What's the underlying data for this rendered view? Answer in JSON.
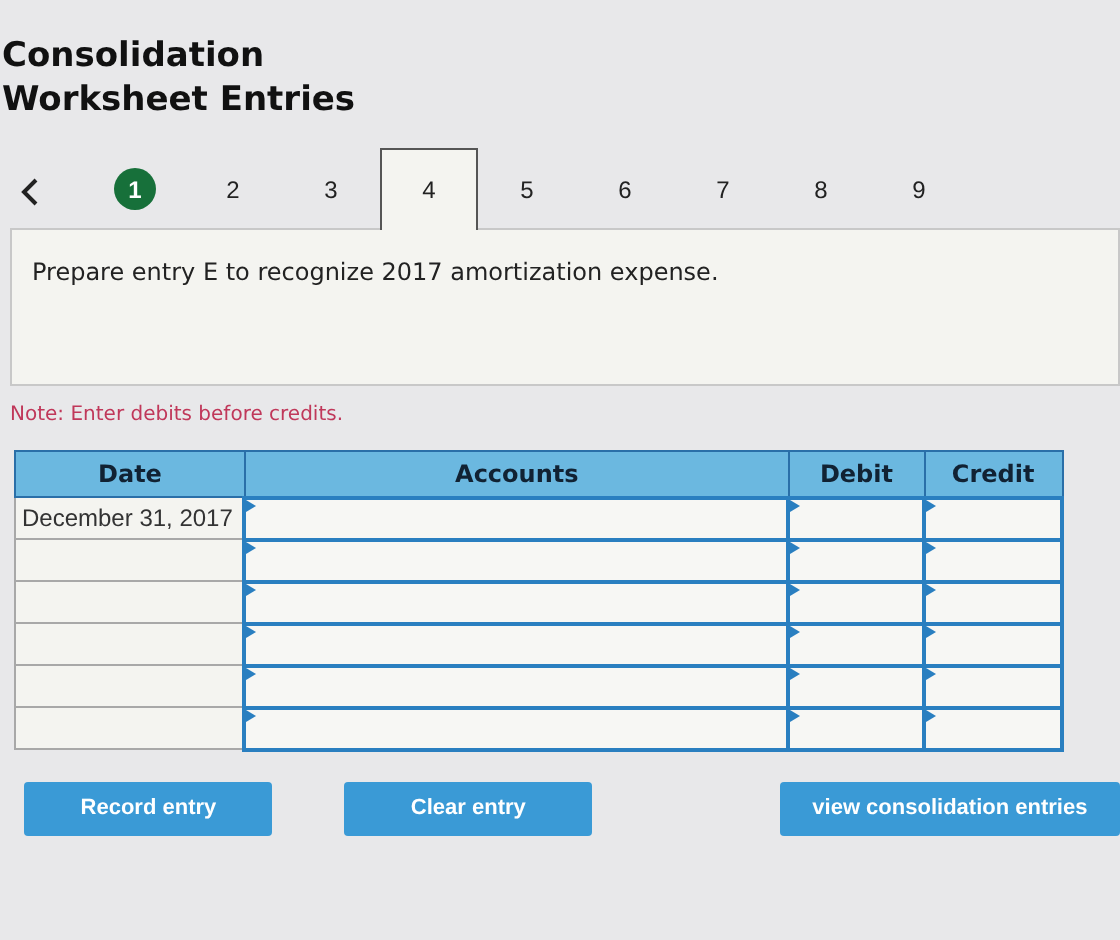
{
  "title": "Consolidation Worksheet Entries",
  "steps": [
    {
      "label": "1",
      "completed": true,
      "selected": false
    },
    {
      "label": "2",
      "completed": false,
      "selected": false
    },
    {
      "label": "3",
      "completed": false,
      "selected": false
    },
    {
      "label": "4",
      "completed": false,
      "selected": true
    },
    {
      "label": "5",
      "completed": false,
      "selected": false
    },
    {
      "label": "6",
      "completed": false,
      "selected": false
    },
    {
      "label": "7",
      "completed": false,
      "selected": false
    },
    {
      "label": "8",
      "completed": false,
      "selected": false
    },
    {
      "label": "9",
      "completed": false,
      "selected": false
    }
  ],
  "prompt": "Prepare entry E to recognize 2017 amortization expense.",
  "note": "Note: Enter debits before credits.",
  "table": {
    "columns": [
      "Date",
      "Accounts",
      "Debit",
      "Credit"
    ],
    "rows": [
      {
        "date": "December 31, 2017"
      },
      {},
      {},
      {},
      {},
      {}
    ]
  },
  "buttons": [
    "Record entry",
    "Clear entry",
    "view consolidation entries"
  ]
}
